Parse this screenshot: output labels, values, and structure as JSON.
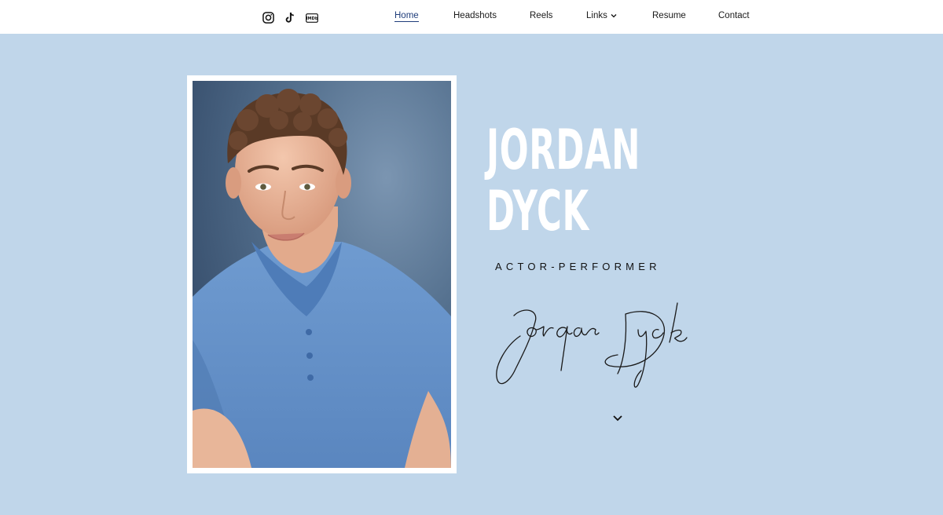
{
  "header": {
    "social": [
      {
        "icon": "instagram-icon"
      },
      {
        "icon": "tiktok-icon"
      },
      {
        "icon": "imdb-icon"
      }
    ],
    "nav": {
      "home": "Home",
      "headshots": "Headshots",
      "reels": "Reels",
      "links": "Links",
      "resume": "Resume",
      "contact": "Contact"
    },
    "active": "Home"
  },
  "hero": {
    "first_name": "JORDAN",
    "last_name": "DYCK",
    "tagline": "ACTOR-PERFORMER",
    "signature": "Jordan Dyck"
  },
  "colors": {
    "background": "#c0d6ea",
    "header": "#ffffff",
    "active_link": "#1f3d7a",
    "name_text": "#ffffff"
  }
}
